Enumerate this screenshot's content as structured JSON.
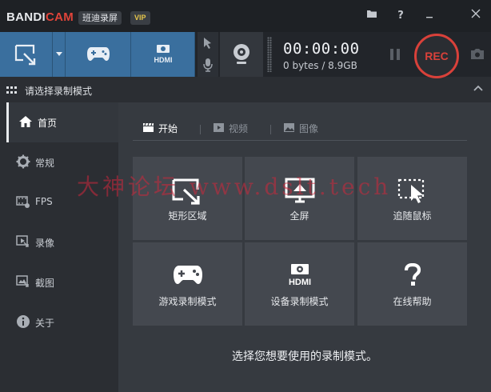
{
  "app": {
    "brand_a": "BANDI",
    "brand_b": "CAM",
    "name_chip": "班迪录屏",
    "vip_badge": "VIP"
  },
  "titlebar_buttons": [
    "folder-icon",
    "help-icon",
    "minimize-icon",
    "close-icon"
  ],
  "toolbar": {
    "timer": "00:00:00",
    "size_status": "0 bytes / 8.9GB",
    "rec_label": "REC"
  },
  "section": {
    "title": "请选择录制模式"
  },
  "sidebar": {
    "items": [
      {
        "label": "首页",
        "icon": "home-icon"
      },
      {
        "label": "常规",
        "icon": "gear-icon"
      },
      {
        "label": "FPS",
        "icon": "fps-icon"
      },
      {
        "label": "录像",
        "icon": "video-icon"
      },
      {
        "label": "截图",
        "icon": "image-icon"
      },
      {
        "label": "关于",
        "icon": "info-icon"
      }
    ]
  },
  "tabs": [
    {
      "label": "开始",
      "icon": "clapper-icon"
    },
    {
      "label": "视频",
      "icon": "play-icon"
    },
    {
      "label": "图像",
      "icon": "picture-icon"
    }
  ],
  "tiles": [
    {
      "label": "矩形区域",
      "icon": "rectangle-area-icon"
    },
    {
      "label": "全屏",
      "icon": "fullscreen-monitor-icon"
    },
    {
      "label": "追随鼠标",
      "icon": "follow-mouse-icon"
    },
    {
      "label": "游戏录制模式",
      "icon": "gamepad-icon"
    },
    {
      "label": "设备录制模式",
      "icon": "hdmi-device-icon"
    },
    {
      "label": "在线帮助",
      "icon": "question-icon"
    }
  ],
  "hint": "选择您想要使用的录制模式。",
  "watermark": "大神论坛 www.dslt.tech",
  "colors": {
    "accent_blue": "#3a6f9e",
    "rec_red": "#d9413a",
    "brand_red": "#e0443a"
  }
}
